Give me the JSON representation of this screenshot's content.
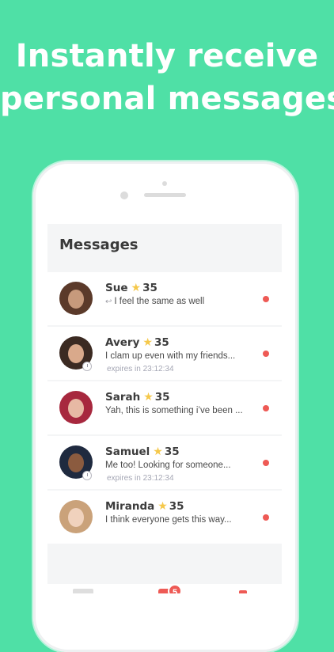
{
  "headline": [
    "Instantly receive",
    "personal messages"
  ],
  "screen": {
    "title": "Messages"
  },
  "conversations": [
    {
      "name": "Sue",
      "score": "35",
      "message": "I feel the same as well",
      "replied": true,
      "expires": "",
      "unread": true,
      "avatar_colors": [
        "#5b3a2a",
        "#c79a7c"
      ]
    },
    {
      "name": "Avery",
      "score": "35",
      "message": "I clam up even with my friends...",
      "replied": false,
      "expires": "expires in 23:12:34",
      "unread": true,
      "avatar_colors": [
        "#3b2a22",
        "#d9a98b"
      ]
    },
    {
      "name": "Sarah",
      "score": "35",
      "message": "Yah, this is something i’ve been ...",
      "replied": false,
      "expires": "",
      "unread": true,
      "avatar_colors": [
        "#a7283e",
        "#e7b9a4"
      ]
    },
    {
      "name": "Samuel",
      "score": "35",
      "message": "Me too!  Looking for someone...",
      "replied": false,
      "expires": "expires in 23:12:34",
      "unread": true,
      "avatar_colors": [
        "#1f2a3f",
        "#8b5b3f"
      ]
    },
    {
      "name": "Miranda",
      "score": "35",
      "message": "I think everyone gets this way...",
      "replied": false,
      "expires": "",
      "unread": true,
      "avatar_colors": [
        "#caa27a",
        "#f0d2bd"
      ]
    }
  ],
  "tabbar": {
    "badge": "5"
  },
  "colors": {
    "background": "#4fe0a6",
    "unread": "#ee5a55",
    "star": "#f5c84a"
  }
}
